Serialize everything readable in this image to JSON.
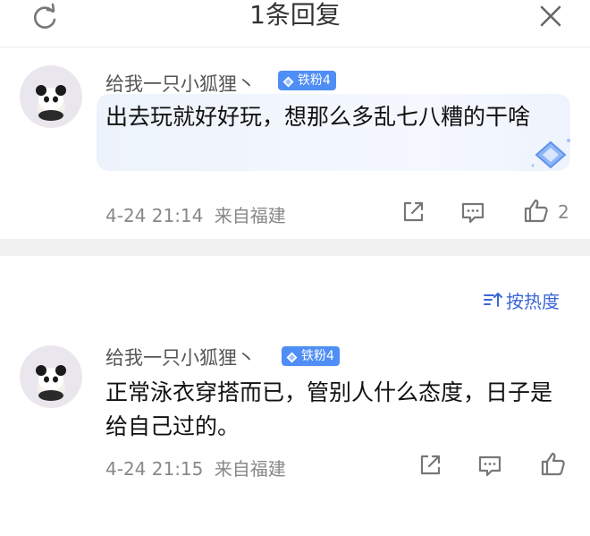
{
  "header": {
    "title": "1条回复"
  },
  "sort": {
    "label": "按热度"
  },
  "comments": [
    {
      "author": "给我一只小狐狸丶",
      "badge": "铁粉4",
      "text": "出去玩就好好玩，想那么多乱七八糟的干啥",
      "time": "4-24 21:14",
      "location": "来自福建",
      "likes": "2"
    },
    {
      "author": "给我一只小狐狸丶",
      "badge": "铁粉4",
      "text": "正常泳衣穿搭而已，管别人什么态度，日子是给自己过的。",
      "time": "4-24 21:15",
      "location": "来自福建",
      "likes": ""
    }
  ],
  "colors": {
    "accent": "#3a66d6",
    "badge": "#4e8ef5",
    "muted_text": "#888888",
    "bubble": "#edf3fc"
  },
  "icons": {
    "refresh": "refresh-icon",
    "close": "close-icon",
    "share": "share-icon",
    "reply": "comment-icon",
    "like": "thumbs-up-icon",
    "sort": "sort-icon"
  }
}
